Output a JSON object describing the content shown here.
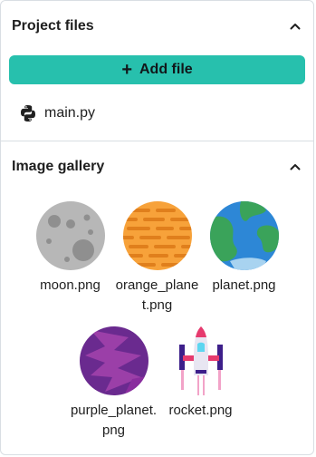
{
  "project_files": {
    "title": "Project files",
    "add_label": "Add file",
    "files": [
      {
        "name": "main.py",
        "icon": "python-icon"
      }
    ]
  },
  "image_gallery": {
    "title": "Image gallery",
    "images": [
      {
        "name": "moon.png",
        "icon": "moon-icon"
      },
      {
        "name": "orange_planet.png",
        "icon": "orange-planet-icon"
      },
      {
        "name": "planet.png",
        "icon": "planet-icon"
      },
      {
        "name": "purple_planet.png",
        "icon": "purple-planet-icon"
      },
      {
        "name": "rocket.png",
        "icon": "rocket-icon"
      }
    ]
  },
  "colors": {
    "accent": "#27c0ad"
  }
}
